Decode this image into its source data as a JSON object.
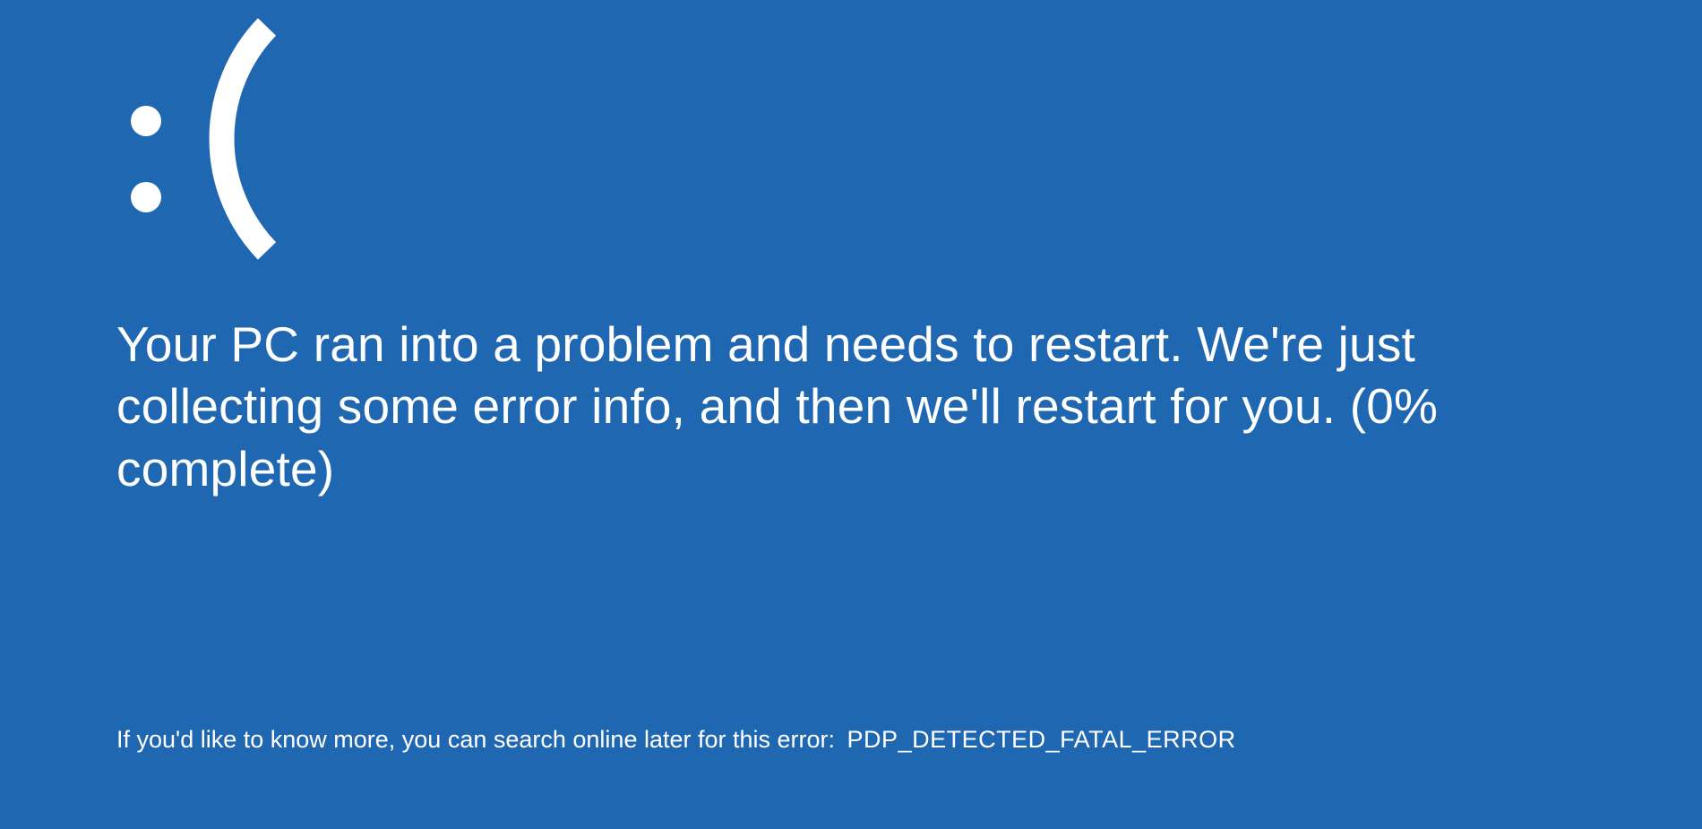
{
  "colors": {
    "background": "#2067b2",
    "text": "#ffffff"
  },
  "sad_face_icon_name": "sad-face-icon",
  "message_line1": "Your PC ran into a problem and needs to restart. We're just",
  "message_line2": "collecting some error info, and then we'll restart for you. (0%",
  "message_line3": "complete)",
  "progress_percent": 0,
  "footer_prefix": "If you'd like to know more, you can search online later for this error:",
  "error_code": "PDP_DETECTED_FATAL_ERROR"
}
